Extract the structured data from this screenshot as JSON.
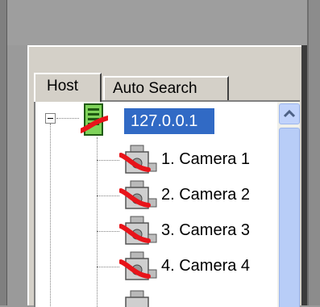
{
  "tabs": [
    {
      "label": "Host"
    },
    {
      "label": "Auto Search"
    }
  ],
  "tree": {
    "host": {
      "label": "127.0.0.1",
      "icon": "host-disconnected-icon"
    },
    "cameras": [
      {
        "label": "1. Camera 1",
        "icon": "camera-disconnected-icon"
      },
      {
        "label": "2. Camera 2",
        "icon": "camera-disconnected-icon"
      },
      {
        "label": "3. Camera 3",
        "icon": "camera-disconnected-icon"
      },
      {
        "label": "4. Camera 4",
        "icon": "camera-disconnected-icon"
      }
    ]
  },
  "colors": {
    "selection": "#316ac5",
    "disconnect_mark": "#e8141a",
    "scrollbar": "#b8cdf7"
  }
}
